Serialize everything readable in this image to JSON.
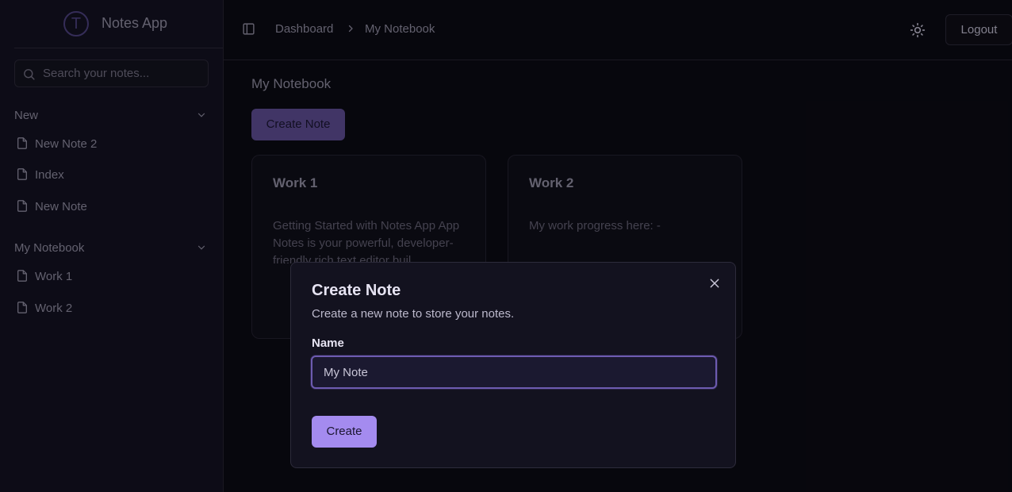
{
  "app": {
    "title": "Notes App",
    "logo_letter": "T"
  },
  "search": {
    "placeholder": "Search your notes..."
  },
  "sidebar": {
    "groups": [
      {
        "label": "New",
        "items": [
          {
            "label": "New Note 2"
          },
          {
            "label": "Index"
          },
          {
            "label": "New Note"
          }
        ]
      },
      {
        "label": "My Notebook",
        "items": [
          {
            "label": "Work 1"
          },
          {
            "label": "Work 2"
          }
        ]
      }
    ]
  },
  "header": {
    "breadcrumb": [
      {
        "label": "Dashboard"
      },
      {
        "label": "My Notebook"
      }
    ],
    "logout_label": "Logout"
  },
  "main": {
    "title": "My Notebook",
    "create_button_label": "Create Note",
    "cards": [
      {
        "title": "Work 1",
        "preview": "Getting Started with Notes App App Notes is your powerful, developer-friendly rich text editor buil..."
      },
      {
        "title": "Work 2",
        "preview": "My work progress here: -"
      }
    ]
  },
  "dialog": {
    "title": "Create Note",
    "description": "Create a new note to store your notes.",
    "field_label": "Name",
    "field_value": "My Note",
    "submit_label": "Create"
  },
  "colors": {
    "accent": "#a48bef",
    "accent_muted": "#5a4a8e",
    "background": "#0b0a12",
    "sidebar": "#121120"
  }
}
